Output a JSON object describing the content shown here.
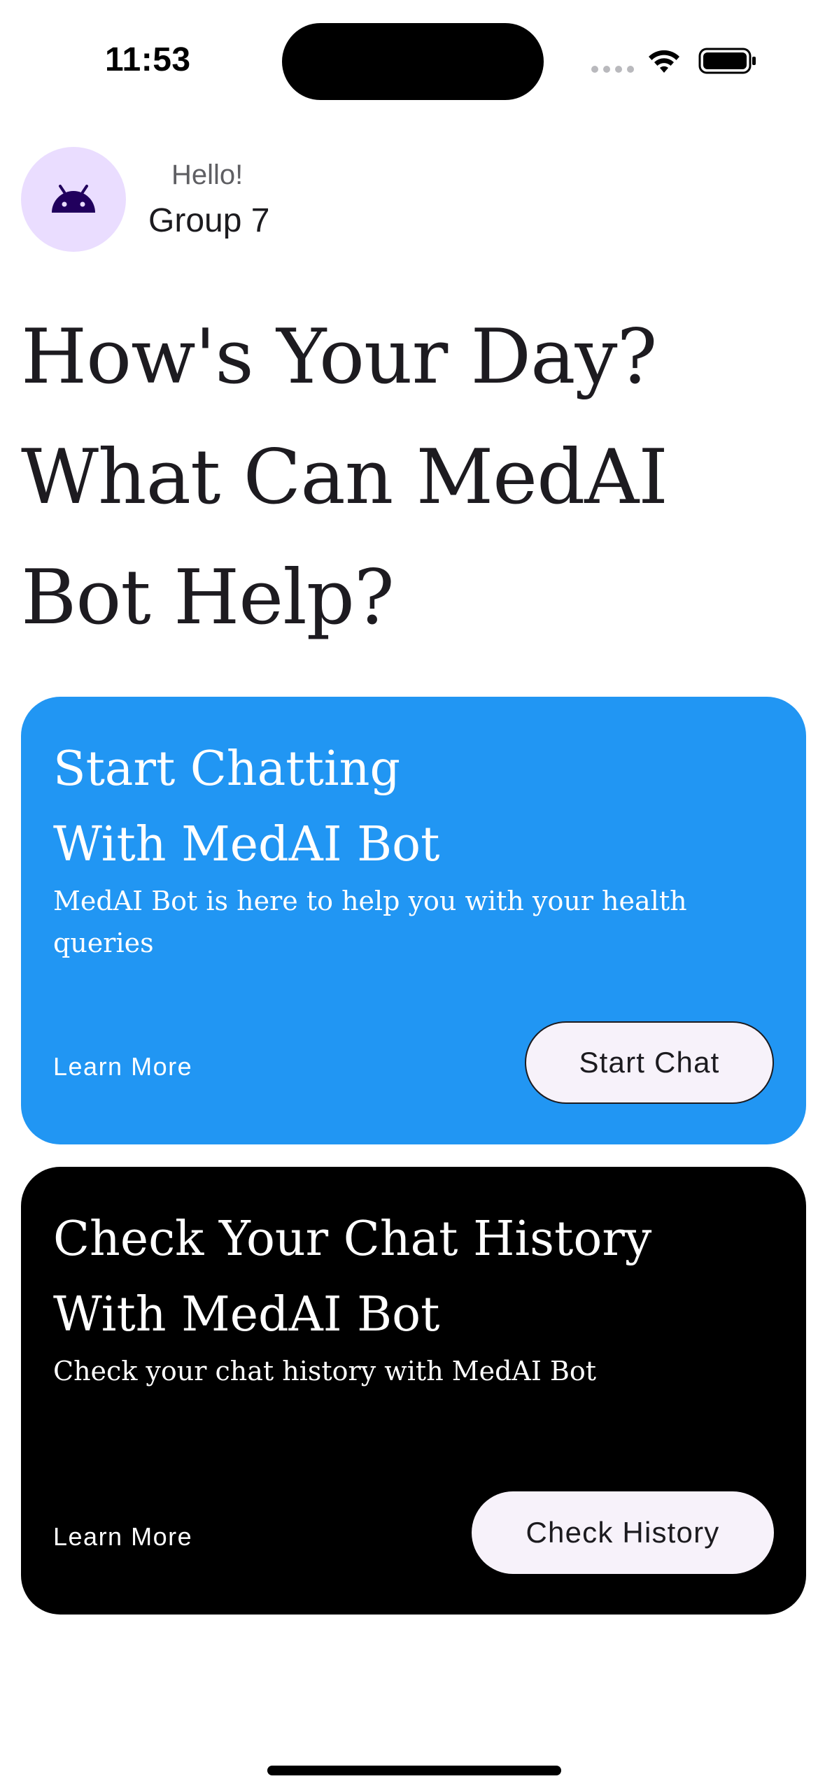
{
  "status_bar": {
    "time": "11:53"
  },
  "header": {
    "greeting": "Hello!",
    "user_name": "Group 7",
    "avatar_icon": "android-icon"
  },
  "headline": {
    "line1": "How's Your Day?",
    "line2": "What Can MedAI",
    "line3": "Bot Help?"
  },
  "cards": [
    {
      "title_line1": "Start Chatting",
      "title_line2": "With MedAI Bot",
      "description": "MedAI Bot is here to help you with your health queries",
      "learn_more": "Learn More",
      "button_label": "Start Chat",
      "background": "#2196f3"
    },
    {
      "title_line1": "Check Your Chat History",
      "title_line2": "With MedAI Bot",
      "description": "Check your chat history with MedAI Bot",
      "learn_more": "Learn More",
      "button_label": "Check History",
      "background": "#000000"
    }
  ],
  "colors": {
    "avatar_bg": "#eaddff",
    "avatar_icon": "#21005d",
    "button_bg": "#f7f2fa"
  }
}
